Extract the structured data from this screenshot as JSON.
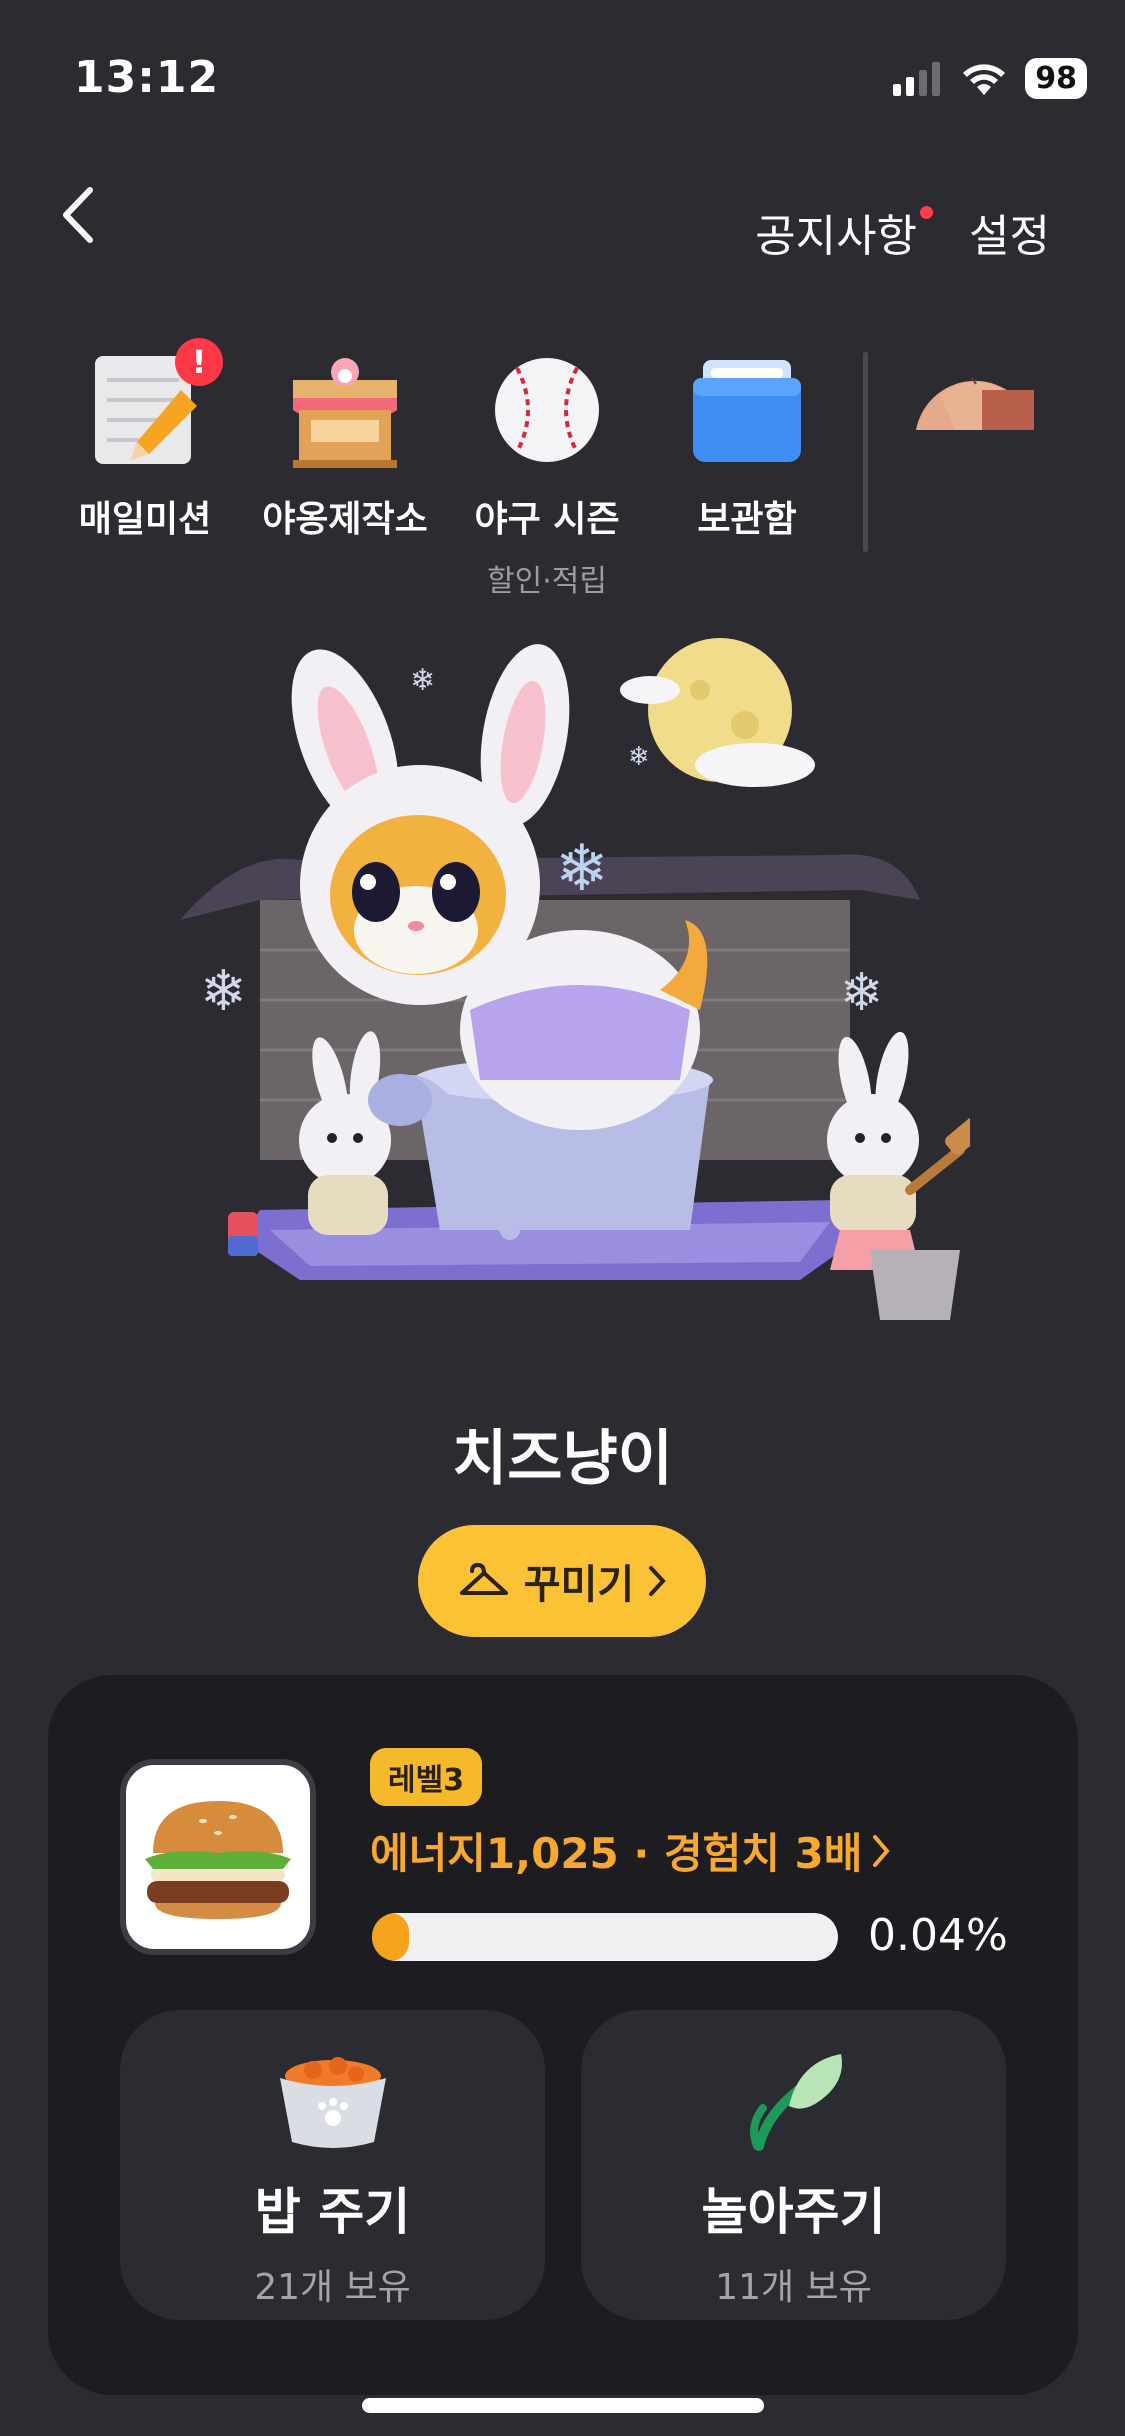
{
  "status_bar": {
    "time": "13:12",
    "battery": "98"
  },
  "header": {
    "notice_label": "공지사항",
    "settings_label": "설정"
  },
  "shortcuts": [
    {
      "label": "매일미션",
      "icon": "mission-pencil-icon",
      "alert": "!"
    },
    {
      "label": "야옹제작소",
      "icon": "cat-workshop-icon"
    },
    {
      "label": "야구 시즌",
      "sub": "할인·적립",
      "icon": "baseball-icon"
    },
    {
      "label": "보관함",
      "icon": "storage-folder-icon"
    },
    {
      "label": "",
      "icon": "profile-partial-icon"
    }
  ],
  "pet": {
    "name": "치즈냥이",
    "decorate_label": "꾸미기"
  },
  "status_panel": {
    "level": "레벨3",
    "energy_text": "에너지1,025 · 경험치 3배",
    "progress_text": "0.04%",
    "progress_fraction": 0.04,
    "food_icon": "hamburger-icon"
  },
  "actions": [
    {
      "title": "밥 주기",
      "sub": "21개 보유",
      "icon": "food-bowl-icon"
    },
    {
      "title": "놀아주기",
      "sub": "11개 보유",
      "icon": "leaf-toy-icon"
    }
  ],
  "colors": {
    "background": "#2b2b31",
    "accent": "#fcc235",
    "energy": "#f7a830",
    "alert": "#ff3848"
  }
}
